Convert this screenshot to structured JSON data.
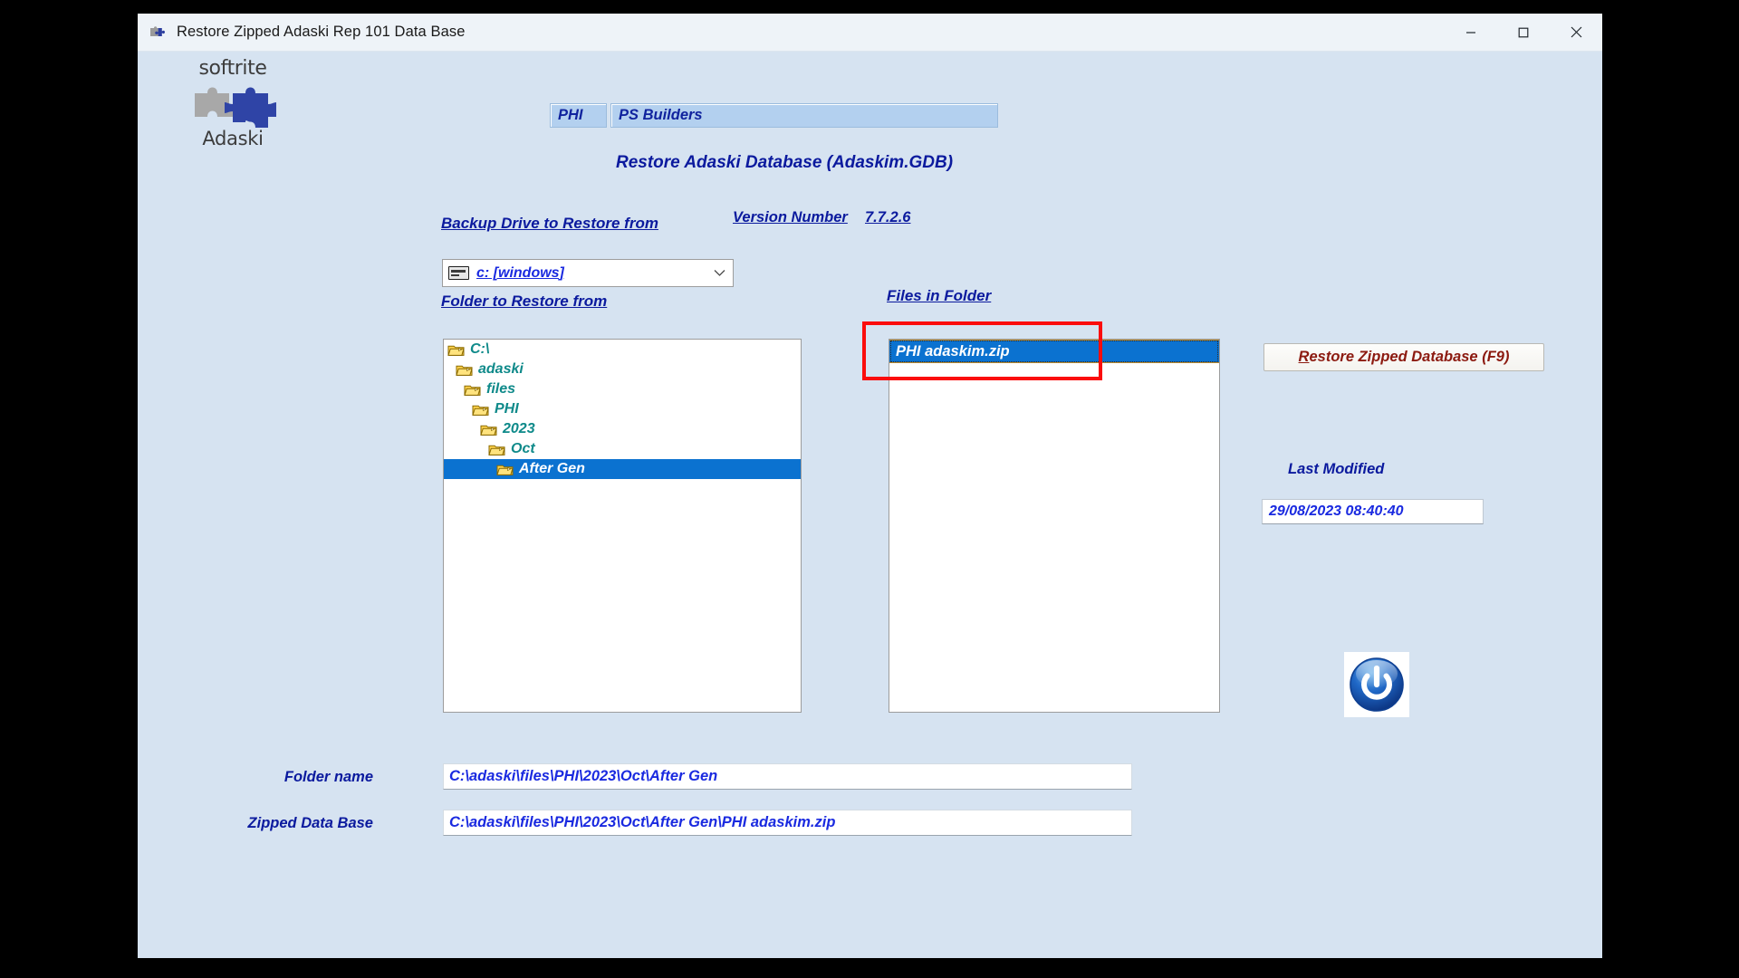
{
  "window": {
    "title": "Restore Zipped Adaski Rep 101 Data Base",
    "icon": "puzzle-icon",
    "controls": {
      "minimize": "minimize-icon",
      "maximize": "maximize-icon",
      "close": "close-icon"
    },
    "background_color": "#d6e3f1",
    "titlebar_color": "#eef3f8"
  },
  "logo": {
    "brand": "softrite",
    "product": "Adaski",
    "puzzle_gray": "#a8a8a8",
    "puzzle_blue": "#2f44a6"
  },
  "header": {
    "code_field": "PHI",
    "company_field": "PS Builders",
    "heading": "Restore Adaski  Database (Adaskim.GDB)",
    "accent_color": "#0b1a9e"
  },
  "version": {
    "label": "Version Number",
    "value": "7.7.2.6"
  },
  "backup_drive": {
    "label": "Backup Drive to Restore from",
    "selected": "c: [windows]",
    "icon": "drive-icon",
    "chevron": "chevron-down-icon"
  },
  "folder_section": {
    "label": "Folder to Restore from",
    "tree": [
      {
        "label": "C:\\",
        "depth": 0,
        "selected": false
      },
      {
        "label": "adaski",
        "depth": 1,
        "selected": false
      },
      {
        "label": "files",
        "depth": 2,
        "selected": false
      },
      {
        "label": "PHI",
        "depth": 3,
        "selected": false
      },
      {
        "label": "2023",
        "depth": 4,
        "selected": false
      },
      {
        "label": "Oct",
        "depth": 5,
        "selected": false
      },
      {
        "label": "After Gen",
        "depth": 6,
        "selected": true
      }
    ],
    "item_color": "#0f8a8a",
    "selected_bg": "#0b72d0"
  },
  "files_section": {
    "label": "Files in Folder",
    "files": [
      {
        "name": "PHI adaskim.zip",
        "selected": true
      }
    ],
    "selected_bg": "#0b72d0"
  },
  "annotation": {
    "shape": "rectangle",
    "color": "#fb0d0d",
    "target": "selected-file-row"
  },
  "actions": {
    "restore_button_accel": "R",
    "restore_button_rest": "estore Zipped Database (F9)",
    "restore_button_color": "#8c1a10",
    "power_button_icon": "power-icon"
  },
  "last_modified": {
    "label": "Last Modified",
    "value": "29/08/2023 08:40:40"
  },
  "bottom_fields": {
    "folder_name_label": "Folder name",
    "folder_name_value": "C:\\adaski\\files\\PHI\\2023\\Oct\\After Gen",
    "zipped_db_label": "Zipped Data Base",
    "zipped_db_value": "C:\\adaski\\files\\PHI\\2023\\Oct\\After Gen\\PHI adaskim.zip"
  }
}
